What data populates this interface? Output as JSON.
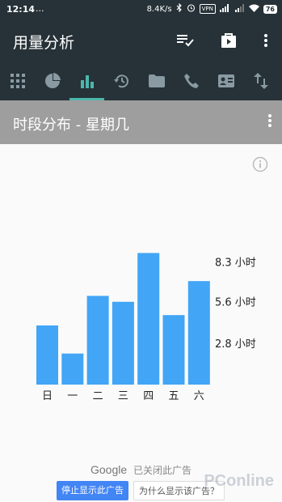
{
  "status_bar": {
    "time": "12:14",
    "dots": "...",
    "speed": "8.4K/s",
    "vpn": "VPN",
    "battery": "76"
  },
  "app": {
    "title": "用量分析",
    "tabs": [
      "apps-grid-icon",
      "pie-chart-icon",
      "bar-chart-icon",
      "history-icon",
      "folder-icon",
      "phone-icon",
      "contact-card-icon",
      "data-transfer-icon"
    ],
    "active_tab": 2
  },
  "section": {
    "title": "时段分布 - 星期几"
  },
  "chart_data": {
    "type": "bar",
    "categories": [
      "日",
      "一",
      "二",
      "三",
      "四",
      "五",
      "六"
    ],
    "values": [
      4.0,
      2.1,
      6.0,
      5.6,
      8.9,
      4.7,
      7.0
    ],
    "ytick_labels": [
      "8.3 小时",
      "5.6 小时",
      "2.8 小时"
    ],
    "ytick_values": [
      8.3,
      5.6,
      2.8
    ],
    "ylim": [
      0,
      9.2
    ],
    "color": "#42a5f5"
  },
  "ads": {
    "brand": "Google",
    "closed_text": "已关闭此广告",
    "stop_button": "停止显示此广告",
    "why_button": "为什么显示该广告？"
  },
  "watermark": "PConline",
  "colors": {
    "appbar": "#263238",
    "accent": "#4db6ac",
    "subbar": "#9e9e9e"
  }
}
